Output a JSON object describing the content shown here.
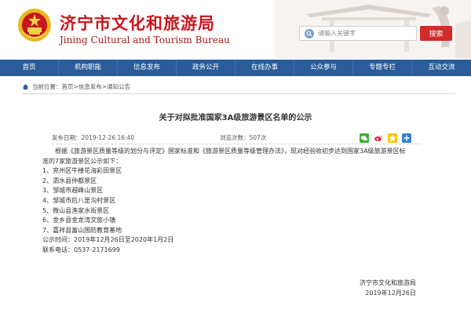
{
  "header": {
    "title_cn": "济宁市文化和旅游局",
    "title_en": "Jining Cultural and Tourism Bureau",
    "search_placeholder": "请输入关键字",
    "search_button": "搜索",
    "colors": {
      "brand_red": "#c8161d",
      "nav_blue": "#2a5c9a",
      "search_red": "#d42a2a"
    }
  },
  "nav": {
    "items": [
      {
        "label": "首页"
      },
      {
        "label": "机构职能"
      },
      {
        "label": "信息发布"
      },
      {
        "label": "政务公开"
      },
      {
        "label": "在线办事"
      },
      {
        "label": "公众参与"
      },
      {
        "label": "专题专栏"
      },
      {
        "label": "互动交流"
      }
    ]
  },
  "breadcrumb": {
    "prefix": "当前位置：",
    "items": [
      "首页",
      "信息发布",
      "通知公告"
    ],
    "separator": " > "
  },
  "article": {
    "title": "关于对拟批准国家3A级旅游景区名单的公示",
    "publish_label": "发布日期：",
    "publish_date": "2019-12-26 16:40",
    "views_label": "浏览次数：",
    "views": "507次",
    "share_icons": [
      "wechat-icon",
      "weibo-icon",
      "qzone-icon",
      "plus-icon"
    ],
    "intro_line1": "根据《旅游景区质量等级的划分与评定》国家标准和《旅游景区质量等级管理办法》，现对经验收初步达到国家3A级旅游景区标",
    "intro_line2": "准的7家旅游景区公示如下：",
    "items": [
      "1、兖州区牛楼花海彩田景区",
      "2、泗水县仲都景区",
      "3、邹城市越峰山景区",
      "4、邹城市后八里沟村景区",
      "5、微山县渔家水街景区",
      "6、金乡县金龙湾文旅小镇",
      "7、嘉祥县富山国防教育基地"
    ],
    "period": "公示时间：2019年12月26日至2020年1月2日",
    "contact": "联系电话：0537-2171699",
    "signature_org": "济宁市文化和旅游局",
    "signature_date": "2019年12月26日"
  }
}
